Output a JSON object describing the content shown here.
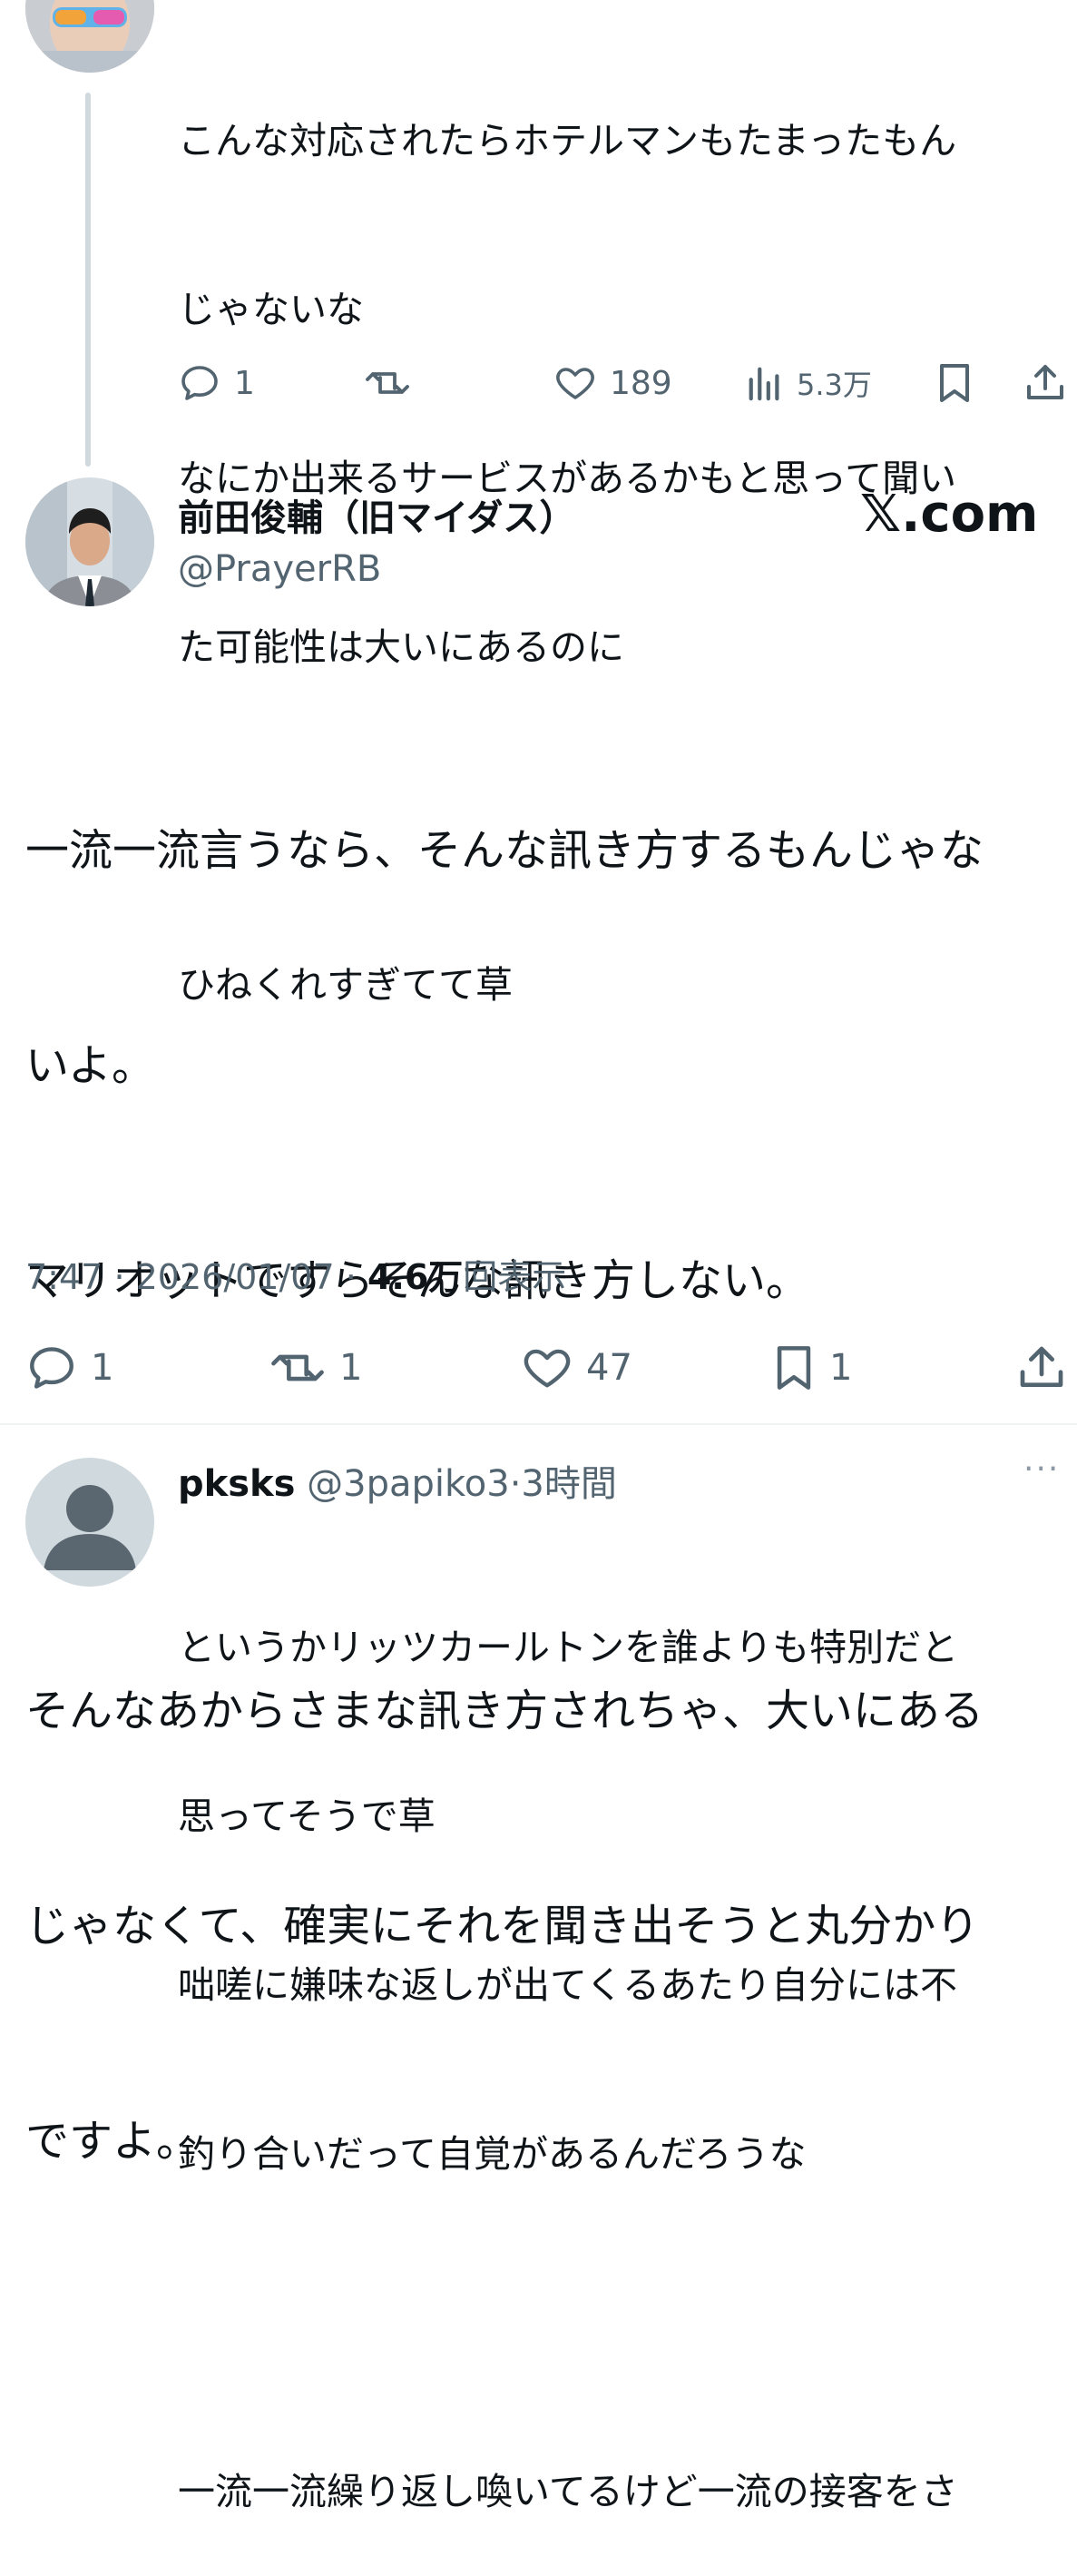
{
  "top_reply": {
    "text_lines": [
      "こんな対応されたらホテルマンもたまったもん",
      "じゃないな",
      "なにか出来るサービスがあるかもと思って聞い",
      "た可能性は大いにあるのに",
      "",
      "ひねくれすぎてて草"
    ],
    "actions": {
      "replies": "1",
      "retweets": "",
      "likes": "189",
      "views": "5.3万"
    }
  },
  "main_tweet": {
    "display_name": "前田俊輔（旧マイダス）",
    "handle": "@PrayerRB",
    "watermark": "𝕏.com",
    "text_lines": [
      "一流一流言うなら、そんな訊き方するもんじゃな",
      "いよ。",
      "マリオットですらそんな訊き方しない。",
      "",
      "そんなあからさまな訊き方されちゃ、大いにある",
      "じゃなくて、確実にそれを聞き出そうと丸分かり",
      "ですよ。"
    ],
    "meta": {
      "time": "7:47",
      "sep1": "·",
      "date": "2026/01/07",
      "sep2": "·",
      "views_count": "4.6万",
      "views_label": "回表示"
    },
    "actions": {
      "replies": "1",
      "retweets": "1",
      "likes": "47",
      "bookmarks": "1"
    }
  },
  "reply": {
    "display_name": "pksks",
    "handle": "@3papiko3",
    "sep": "·",
    "time": "3時間",
    "more": "···",
    "text_lines": [
      "というかリッツカールトンを誰よりも特別だと",
      "思ってそうで草",
      "咄嗟に嫌味な返しが出てくるあたり自分には不",
      "釣り合いだって自覚があるんだろうな",
      "",
      "一流一流繰り返し喚いてるけど一流の接客をさ"
    ]
  },
  "colors": {
    "text": "#0f1419",
    "secondary": "#536471",
    "thread_line": "#cfd9de",
    "divider": "#eff3f4"
  }
}
